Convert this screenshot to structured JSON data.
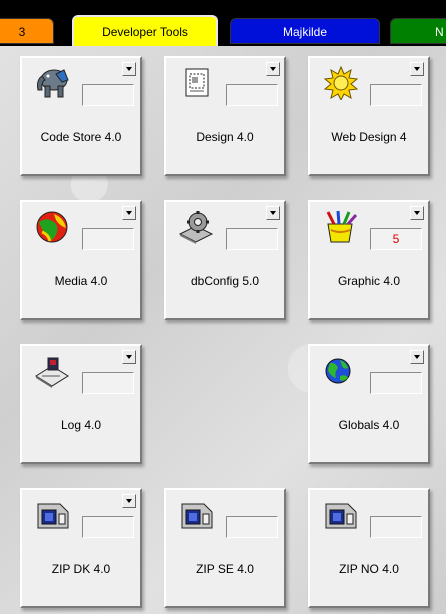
{
  "tabs": [
    {
      "label": "3"
    },
    {
      "label": "Developer Tools"
    },
    {
      "label": "Majkilde"
    },
    {
      "label": "N"
    }
  ],
  "tiles": [
    {
      "label": "Code Store 4.0",
      "icon": "elephant-icon",
      "value": ""
    },
    {
      "label": "Design 4.0",
      "icon": "design-doc-icon",
      "value": ""
    },
    {
      "label": "Web Design 4",
      "icon": "sun-icon",
      "value": ""
    },
    {
      "label": "Media 4.0",
      "icon": "media-globe-icon",
      "value": ""
    },
    {
      "label": "dbConfig 5.0",
      "icon": "gear-disk-icon",
      "value": ""
    },
    {
      "label": "Graphic 4.0",
      "icon": "paint-cup-icon",
      "value": "5"
    },
    {
      "label": "Log 4.0",
      "icon": "log-book-icon",
      "value": ""
    },
    {
      "label": "Globals 4.0",
      "icon": "globe-icon",
      "value": ""
    },
    {
      "label": "ZIP DK 4.0",
      "icon": "zip-drive-icon",
      "value": ""
    },
    {
      "label": "ZIP SE 4.0",
      "icon": "zip-drive-icon",
      "value": ""
    },
    {
      "label": "ZIP NO 4.0",
      "icon": "zip-drive-icon",
      "value": ""
    }
  ]
}
